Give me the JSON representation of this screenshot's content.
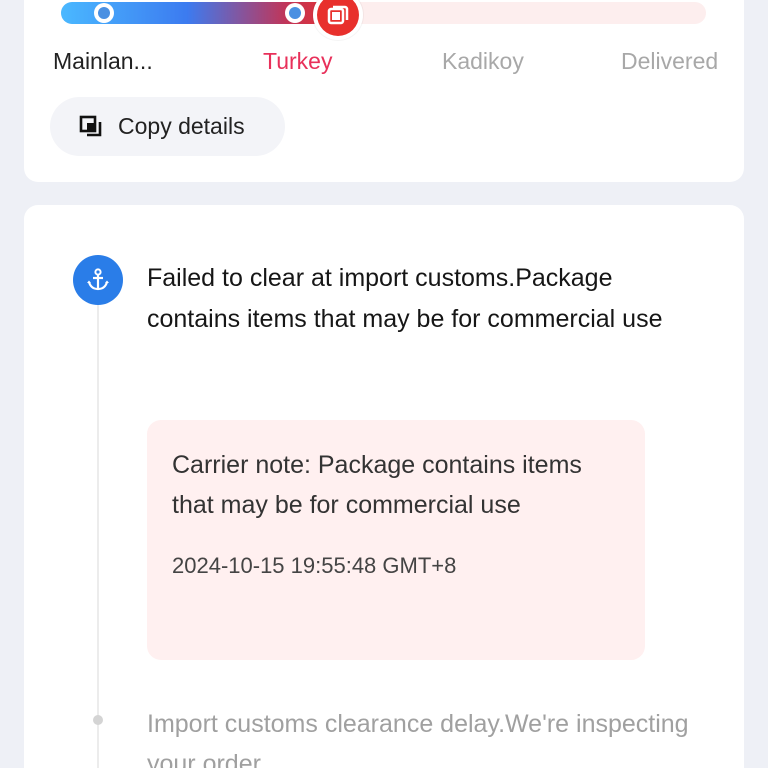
{
  "progress": {
    "fraction_complete": 0.4,
    "stages": [
      {
        "label": "Mainlan...",
        "state": "done"
      },
      {
        "label": "Turkey",
        "state": "current"
      },
      {
        "label": "Kadikoy",
        "state": "pending"
      },
      {
        "label": "Delivered",
        "state": "pending"
      }
    ],
    "current_icon": "customs-box-icon",
    "colors": {
      "start": "#4ab8ff",
      "current": "#e8302c",
      "pending_track": "#fdeeee",
      "current_label": "#e8305a"
    }
  },
  "copy_button": {
    "label": "Copy details",
    "icon": "copy-icon"
  },
  "events": [
    {
      "icon": "anchor-icon",
      "title": "Failed to clear at import customs.Package contains items that may be for commercial use",
      "note": "Carrier note: Package contains items that may be for commercial use",
      "time": "2024-10-15 19:55:48 GMT+8"
    },
    {
      "title": "Import customs clearance delay.We're inspecting your order"
    }
  ]
}
